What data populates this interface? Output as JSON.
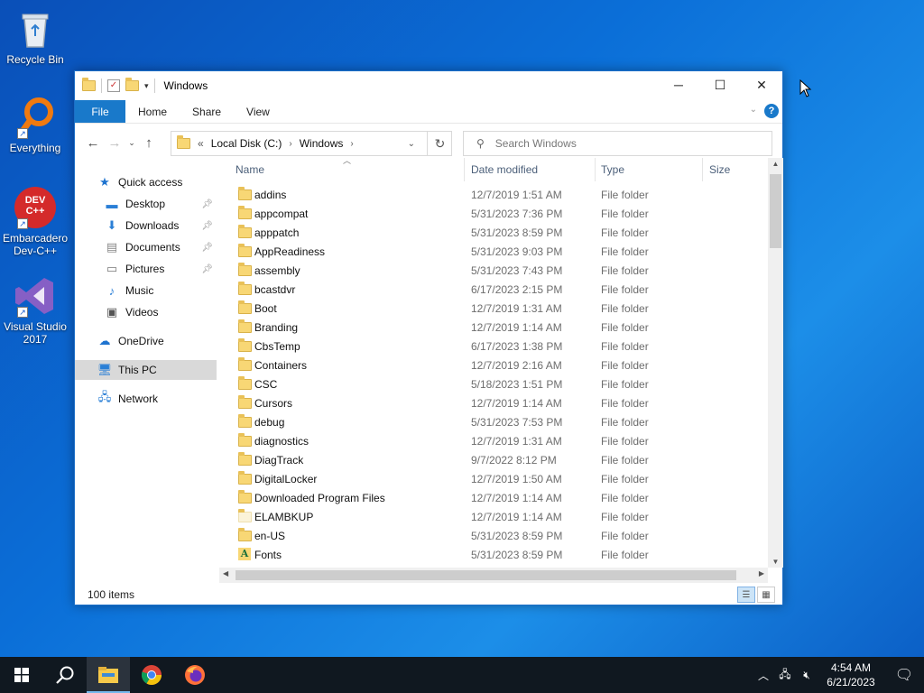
{
  "desktop": {
    "icons": [
      {
        "label": "Recycle Bin",
        "icon": "recycle-bin-icon"
      },
      {
        "label": "Everything",
        "icon": "everything-search-icon"
      },
      {
        "label": "Embarcadero Dev-C++",
        "icon": "devcpp-icon",
        "badge": "DEV C++"
      },
      {
        "label": "Visual Studio 2017",
        "icon": "visual-studio-icon"
      }
    ]
  },
  "window": {
    "title": "Windows",
    "controls": {
      "minimize": "─",
      "maximize": "☐",
      "close": "✕"
    },
    "ribbon_tabs": [
      "File",
      "Home",
      "Share",
      "View"
    ],
    "help": "?",
    "address": {
      "prefix": "«",
      "segments": [
        "Local Disk (C:)",
        "Windows"
      ]
    },
    "search_placeholder": "Search Windows",
    "nav": {
      "quick_access": "Quick access",
      "items": [
        "Desktop",
        "Downloads",
        "Documents",
        "Pictures",
        "Music",
        "Videos"
      ],
      "onedrive": "OneDrive",
      "this_pc": "This PC",
      "network": "Network"
    },
    "columns": [
      "Name",
      "Date modified",
      "Type",
      "Size"
    ],
    "rows": [
      {
        "name": "addins",
        "date": "12/7/2019 1:51 AM",
        "type": "File folder"
      },
      {
        "name": "appcompat",
        "date": "5/31/2023 7:36 PM",
        "type": "File folder"
      },
      {
        "name": "apppatch",
        "date": "5/31/2023 8:59 PM",
        "type": "File folder"
      },
      {
        "name": "AppReadiness",
        "date": "5/31/2023 9:03 PM",
        "type": "File folder"
      },
      {
        "name": "assembly",
        "date": "5/31/2023 7:43 PM",
        "type": "File folder"
      },
      {
        "name": "bcastdvr",
        "date": "6/17/2023 2:15 PM",
        "type": "File folder"
      },
      {
        "name": "Boot",
        "date": "12/7/2019 1:31 AM",
        "type": "File folder"
      },
      {
        "name": "Branding",
        "date": "12/7/2019 1:14 AM",
        "type": "File folder"
      },
      {
        "name": "CbsTemp",
        "date": "6/17/2023 1:38 PM",
        "type": "File folder"
      },
      {
        "name": "Containers",
        "date": "12/7/2019 2:16 AM",
        "type": "File folder"
      },
      {
        "name": "CSC",
        "date": "5/18/2023 1:51 PM",
        "type": "File folder"
      },
      {
        "name": "Cursors",
        "date": "12/7/2019 1:14 AM",
        "type": "File folder"
      },
      {
        "name": "debug",
        "date": "5/31/2023 7:53 PM",
        "type": "File folder"
      },
      {
        "name": "diagnostics",
        "date": "12/7/2019 1:31 AM",
        "type": "File folder"
      },
      {
        "name": "DiagTrack",
        "date": "9/7/2022 8:12 PM",
        "type": "File folder"
      },
      {
        "name": "DigitalLocker",
        "date": "12/7/2019 1:50 AM",
        "type": "File folder"
      },
      {
        "name": "Downloaded Program Files",
        "date": "12/7/2019 1:14 AM",
        "type": "File folder"
      },
      {
        "name": "ELAMBKUP",
        "date": "12/7/2019 1:14 AM",
        "type": "File folder"
      },
      {
        "name": "en-US",
        "date": "5/31/2023 8:59 PM",
        "type": "File folder"
      },
      {
        "name": "Fonts",
        "date": "5/31/2023 8:59 PM",
        "type": "File folder"
      }
    ],
    "status": "100 items"
  },
  "taskbar": {
    "apps": [
      "start-icon",
      "search-icon",
      "file-explorer-icon",
      "chrome-icon",
      "firefox-icon"
    ],
    "time": "4:54 AM",
    "date": "6/21/2023"
  }
}
